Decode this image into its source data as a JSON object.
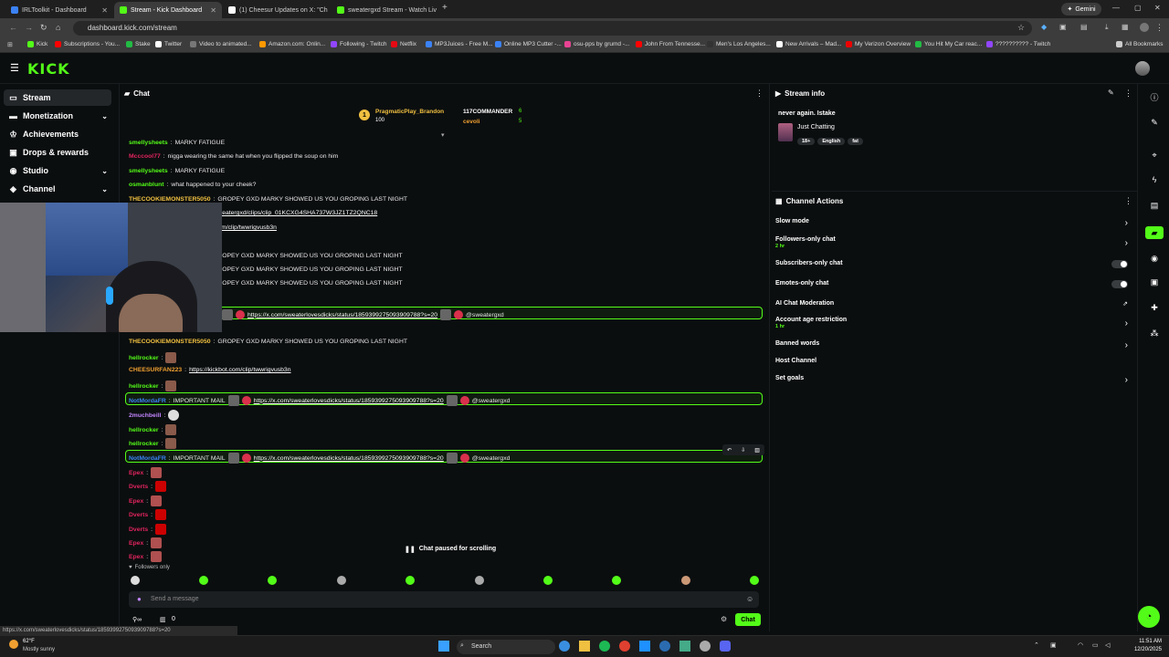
{
  "browser": {
    "tabs": [
      {
        "label": "IRLToolkit - Dashboard",
        "color": "#3b82f6",
        "active": false
      },
      {
        "label": "Stream - Kick Dashboard",
        "color": "#53fc18",
        "active": true
      },
      {
        "label": "(1) Cheesur Updates on X: \"Ch",
        "color": "#ffffff",
        "active": false
      },
      {
        "label": "sweatergxd Stream - Watch Liv",
        "color": "#53fc18",
        "active": false
      }
    ],
    "url": "dashboard.kick.com/stream",
    "gemini_label": "Gemini",
    "bookmarks": [
      {
        "label": "Kick",
        "color": "#53fc18"
      },
      {
        "label": "Subscriptions - You...",
        "color": "#ff0000"
      },
      {
        "label": "Stake",
        "color": "#2b4"
      },
      {
        "label": "Twitter",
        "color": "#fff"
      },
      {
        "label": "Video to animated...",
        "color": "#777"
      },
      {
        "label": "Amazon.com: Onlin...",
        "color": "#f90"
      },
      {
        "label": "Following - Twitch",
        "color": "#9146ff"
      },
      {
        "label": "Netflix",
        "color": "#e50914"
      },
      {
        "label": "MP3Juices - Free M...",
        "color": "#3b82f6"
      },
      {
        "label": "Online MP3 Cutter -...",
        "color": "#3b82f6"
      },
      {
        "label": "osu-pps by grumd -...",
        "color": "#e84393"
      },
      {
        "label": "John From Tennesse...",
        "color": "#ff0000"
      },
      {
        "label": "Men's Los Angeles...",
        "color": "#333"
      },
      {
        "label": "New Arrivals – Mad...",
        "color": "#fff"
      },
      {
        "label": "My Verizon Overview",
        "color": "#e00"
      },
      {
        "label": "You Hit My Car reac...",
        "color": "#2b4"
      },
      {
        "label": "?????????? - Twitch",
        "color": "#9146ff"
      }
    ],
    "all_bookmarks_label": "All Bookmarks",
    "status_url": "https://x.com/sweaterlovesdicks/status/1859399275093909788?s=20"
  },
  "kick": {
    "logo": "KICK",
    "nav": [
      {
        "label": "Stream",
        "icon": "stream-icon",
        "active": true,
        "chevron": false
      },
      {
        "label": "Monetization",
        "icon": "dollar-icon",
        "active": false,
        "chevron": true
      },
      {
        "label": "Achievements",
        "icon": "trophy-icon",
        "active": false,
        "chevron": false
      },
      {
        "label": "Drops & rewards",
        "icon": "gift-icon",
        "active": false,
        "chevron": false
      },
      {
        "label": "Studio",
        "icon": "studio-icon",
        "active": false,
        "chevron": true
      },
      {
        "label": "Channel",
        "icon": "channel-icon",
        "active": false,
        "chevron": true
      }
    ]
  },
  "chat": {
    "title": "Chat",
    "top_gifters": [
      {
        "name": "PragmaticPlay_Brandon",
        "count": "100"
      },
      {
        "name": "117COMMANDER",
        "count": "6"
      },
      {
        "name": "cevoli",
        "count": "5"
      }
    ],
    "messages": [
      {
        "user": "smellysheets",
        "color": "#53fc18",
        "text": "MARKY FATIGUE"
      },
      {
        "user": "Mcccool77",
        "color": "#e0245e",
        "text": "nigga wearing the same hat when you flipped the soup on him"
      },
      {
        "user": "smellysheets",
        "color": "#53fc18",
        "text": "MARKY FATIGUE"
      },
      {
        "user": "osmanblunt",
        "color": "#53fc18",
        "text": "what happened to your cheek?"
      },
      {
        "user": "THECOOKIEMONSTER5050",
        "color": "#f0c040",
        "text": "GROPEY GXD MARKY SHOWED US YOU GROPING LAST NIGHT"
      },
      {
        "user": "",
        "color": "#fff",
        "text": "/sweatergxd/clips/clip_01KCXG4SHA737W3JZ1TZ2QNC18",
        "link": true
      },
      {
        "user": "",
        "color": "#fff",
        "text": ".com/clip/twwrigvusb3n",
        "link": true
      },
      {
        "user": "",
        "color": "#fff",
        "text": "GROPEY GXD MARKY SHOWED US YOU GROPING LAST NIGHT"
      },
      {
        "user": "",
        "color": "#fff",
        "text": "GROPEY GXD MARKY SHOWED US YOU GROPING LAST NIGHT"
      },
      {
        "user": "",
        "color": "#fff",
        "text": "GROPEY GXD MARKY SHOWED US YOU GROPING LAST NIGHT"
      }
    ],
    "hl_link": "https://x.com/sweaterlovesdicks/status/1859399275093909788?s=20",
    "hl_mention": "@sweatergxd",
    "messages2": [
      {
        "user": "THECOOKIEMONSTER5050",
        "color": "#f0c040",
        "text": "GROPEY GXD MARKY SHOWED US YOU GROPING LAST NIGHT"
      },
      {
        "user": "hellrocker",
        "color": "#53fc18",
        "text": ""
      },
      {
        "user": "CHEESURFAN223",
        "color": "#f0a030",
        "text": "https://kickbot.com/clip/twwrigvusb3n",
        "link": true
      },
      {
        "user": "hellrocker",
        "color": "#53fc18",
        "text": ""
      }
    ],
    "important_user": "NotMordaFR",
    "important_text": "IMPORTANT MAIL",
    "messages3": [
      {
        "user": "2muchbeill",
        "color": "#c084fc"
      },
      {
        "user": "hellrocker",
        "color": "#53fc18"
      },
      {
        "user": "hellrocker",
        "color": "#53fc18"
      }
    ],
    "messages4": [
      {
        "user": "Epex",
        "color": "#e0245e"
      },
      {
        "user": "Dverts",
        "color": "#e0245e"
      },
      {
        "user": "Epex",
        "color": "#e0245e"
      },
      {
        "user": "Dverts",
        "color": "#e0245e"
      },
      {
        "user": "Dverts",
        "color": "#e0245e"
      },
      {
        "user": "Epex",
        "color": "#e0245e"
      },
      {
        "user": "Epex",
        "color": "#e0245e"
      }
    ],
    "paused_label": "Chat paused for scrolling",
    "followers_only": "Followers only",
    "input_placeholder": "Send a message",
    "send_label": "Chat",
    "footer_count": "0"
  },
  "stream_info": {
    "title": "Stream info",
    "stream_title": "never again. Istake",
    "category": "Just Chatting",
    "tags": [
      "18+",
      "English",
      "fat"
    ]
  },
  "channel_actions": {
    "title": "Channel Actions",
    "items": [
      {
        "label": "Slow mode",
        "sub": "",
        "control": "arrow"
      },
      {
        "label": "Followers-only chat",
        "sub": "2 hr",
        "control": "arrow"
      },
      {
        "label": "Subscribers-only chat",
        "sub": "",
        "control": "toggle"
      },
      {
        "label": "Emotes-only chat",
        "sub": "",
        "control": "toggle"
      },
      {
        "label": "AI Chat Moderation",
        "sub": "",
        "control": "external"
      },
      {
        "label": "Account age restriction",
        "sub": "1 hr",
        "control": "arrow"
      },
      {
        "label": "Banned words",
        "sub": "",
        "control": "arrow"
      },
      {
        "label": "Host Channel",
        "sub": "",
        "control": "none"
      },
      {
        "label": "Set goals",
        "sub": "",
        "control": "arrow"
      }
    ]
  },
  "taskbar": {
    "weather_temp": "62°F",
    "weather_desc": "Mostly sunny",
    "search_label": "Search",
    "time": "11:51 AM",
    "date": "12/20/2025"
  },
  "colors": {
    "accent": "#53fc18",
    "bg": "#0b0e0f"
  }
}
